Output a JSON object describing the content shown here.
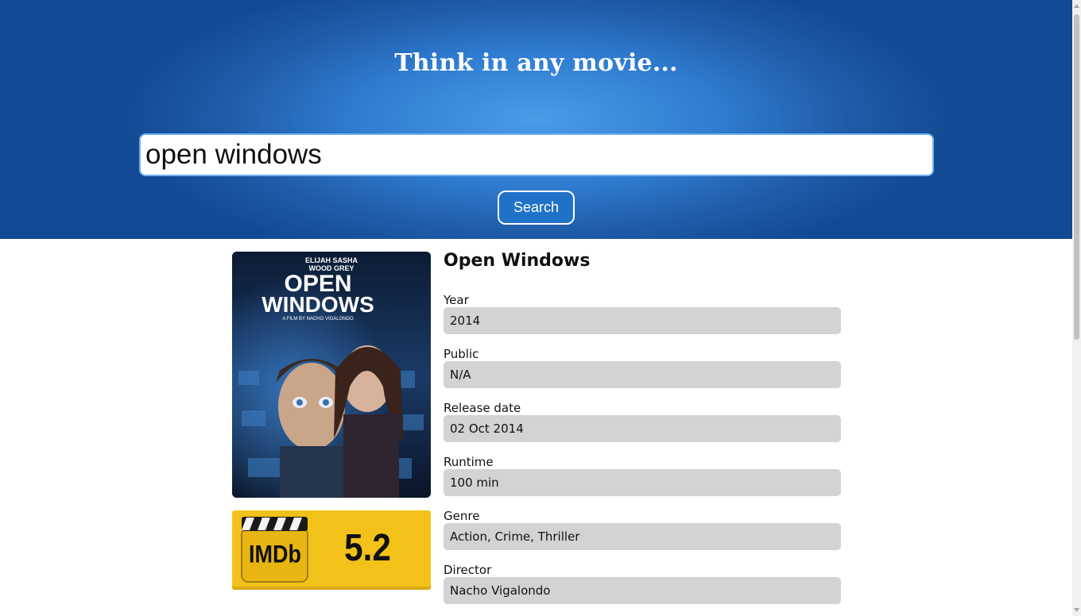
{
  "header": {
    "title": "Think in any movie...",
    "search_value": "open windows",
    "search_button_label": "Search"
  },
  "movie": {
    "title": "Open Windows",
    "poster": {
      "actors": [
        "ELIJAH",
        "WOOD",
        "SASHA",
        "GREY"
      ],
      "title_line1": "OPEN",
      "title_line2": "WINDOWS",
      "credit": "A FILM BY NACHO VIGALONDO"
    },
    "imdb": {
      "logo_text": "IMDb",
      "rating": "5.2"
    },
    "fields": [
      {
        "label": "Year",
        "value": "2014"
      },
      {
        "label": "Public",
        "value": "N/A"
      },
      {
        "label": "Release date",
        "value": "02 Oct 2014"
      },
      {
        "label": "Runtime",
        "value": "100 min"
      },
      {
        "label": "Genre",
        "value": "Action, Crime, Thriller"
      },
      {
        "label": "Director",
        "value": "Nacho Vigalondo"
      }
    ]
  },
  "colors": {
    "hero_center": "#4a9ce8",
    "hero_edge": "#134a94",
    "button_bg": "#1f72c8",
    "field_bg": "#d3d3d3",
    "imdb_yellow": "#f2c21b"
  },
  "icons": [
    "imdb-logo-icon",
    "scroll-up-arrow-icon",
    "scroll-down-arrow-icon"
  ]
}
